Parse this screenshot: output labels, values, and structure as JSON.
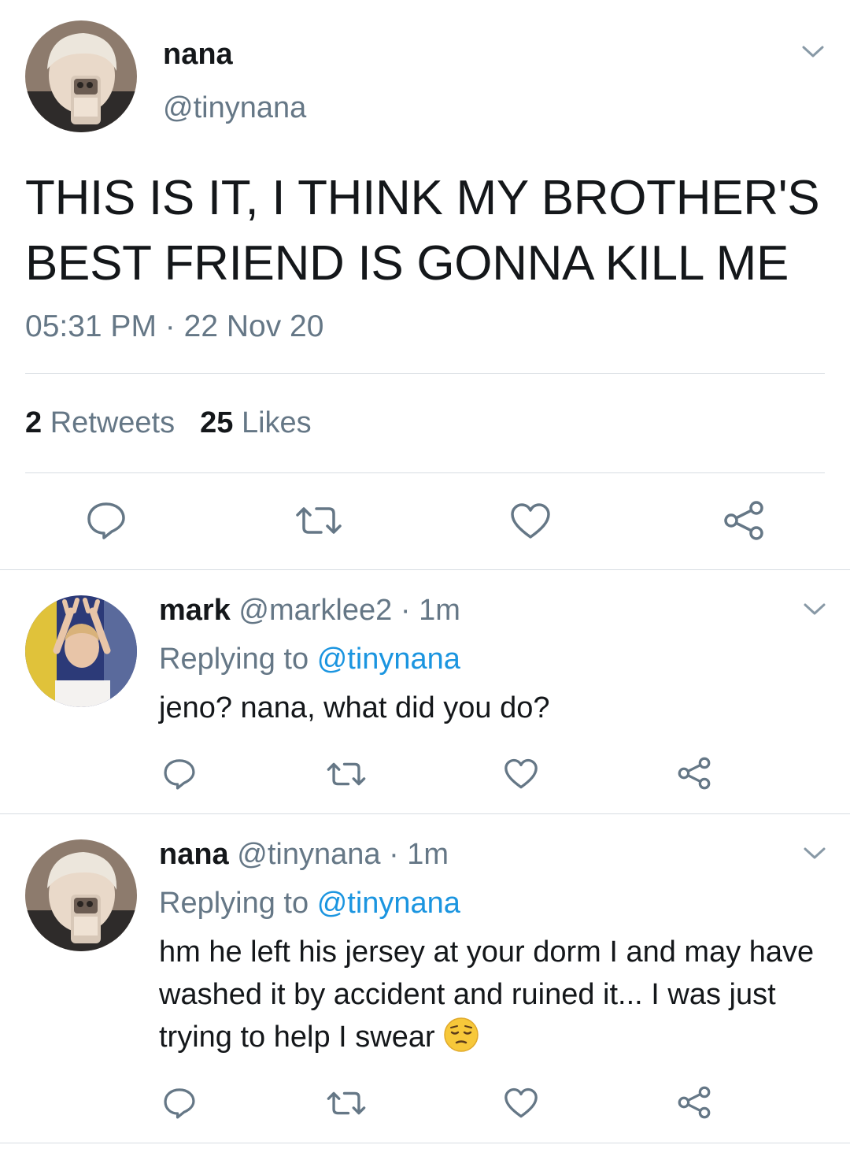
{
  "main_tweet": {
    "display_name": "nana",
    "handle": "@tinynana",
    "text": "THIS IS IT, I THINK MY BROTHER'S BEST FRIEND IS GONNA KILL ME",
    "time": "05:31 PM",
    "separator": "·",
    "date": "22 Nov 20",
    "retweets_count": "2",
    "retweets_label": "Retweets",
    "likes_count": "25",
    "likes_label": "Likes",
    "avatar_icon": "profile-photo-blonde-selfie",
    "menu_icon": "chevron-down-icon"
  },
  "replies": [
    {
      "display_name": "mark",
      "handle": "@marklee2",
      "separator": "·",
      "time": "1m",
      "replying_label": "Replying to",
      "replying_to": "@tinynana",
      "text": "jeno? nana, what did you do?",
      "avatar_icon": "profile-photo-peace-sign"
    },
    {
      "display_name": "nana",
      "handle": "@tinynana",
      "separator": "·",
      "time": "1m",
      "replying_label": "Replying to",
      "replying_to": "@tinynana",
      "text": "hm he left his jersey at your dorm I and may have washed it by accident and ruined it... I was just trying to help I swear",
      "emoji": "pensive-face",
      "avatar_icon": "profile-photo-blonde-selfie"
    }
  ],
  "actions": [
    "reply-icon",
    "retweet-icon",
    "like-icon",
    "share-icon"
  ],
  "colors": {
    "text": "#14171a",
    "secondary": "#657786",
    "link": "#1b95e0",
    "icon": "#657786",
    "divider": "#d8dde2"
  }
}
